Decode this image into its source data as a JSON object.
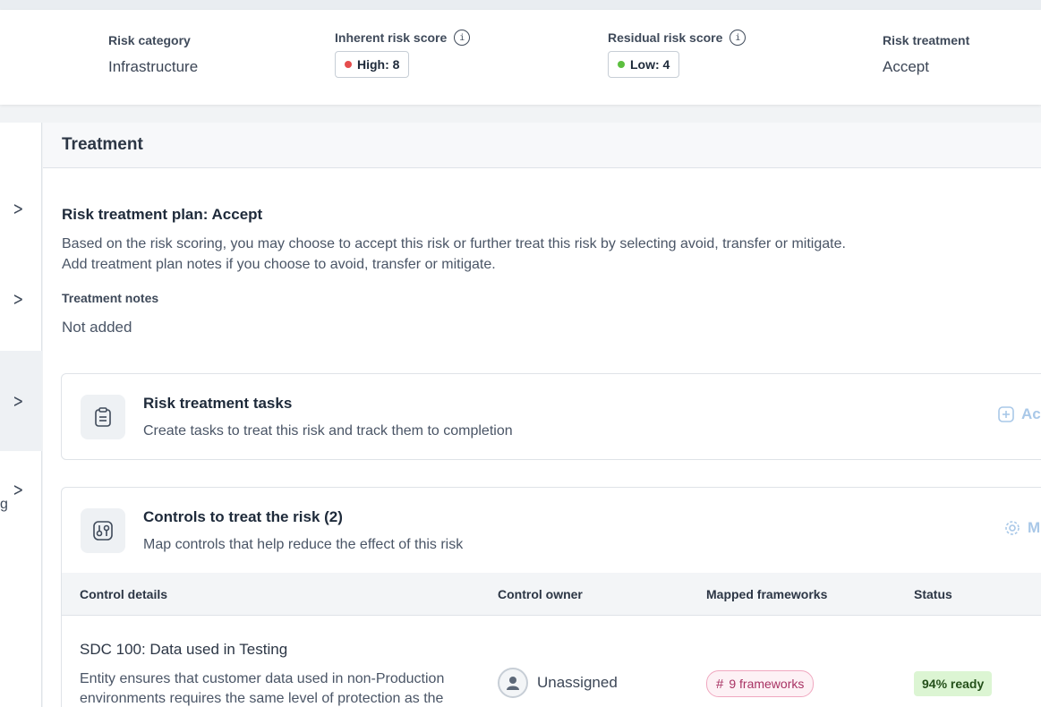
{
  "summary": {
    "risk_category": {
      "label": "Risk category",
      "value": "Infrastructure"
    },
    "inherent": {
      "label": "Inherent risk score",
      "info_icon_text": "i",
      "badge": "High: 8",
      "dot_color": "#e54d4d"
    },
    "residual": {
      "label": "Residual risk score",
      "info_icon_text": "i",
      "badge": "Low: 4",
      "dot_color": "#5cbf3f"
    },
    "treatment": {
      "label": "Risk treatment",
      "value": "Accept"
    }
  },
  "left_nav": {
    "partial_text": "g"
  },
  "section": {
    "title": "Treatment",
    "plan_title": "Risk treatment plan: Accept",
    "plan_desc_line1": "Based on the risk scoring, you may choose to accept this risk or further treat this risk by selecting avoid, transfer or mitigate.",
    "plan_desc_line2": "Add treatment plan notes if you choose to avoid, transfer or mitigate.",
    "notes_label": "Treatment notes",
    "notes_value": "Not added"
  },
  "tasks_card": {
    "icon": "clipboard-icon",
    "title": "Risk treatment tasks",
    "subtitle": "Create tasks to treat this risk and track them to completion",
    "action_label": "Ac"
  },
  "controls_card": {
    "icon": "controls-icon",
    "title": "Controls to treat the risk (2)",
    "subtitle": "Map controls that help reduce the effect of this risk",
    "action_label": "M",
    "columns": [
      "Control details",
      "Control owner",
      "Mapped frameworks",
      "Status"
    ],
    "rows": [
      {
        "title": "SDC 100: Data used in Testing",
        "desc_line1": "Entity ensures that customer data used in non-Production",
        "desc_line2": "environments requires the same level of protection as the",
        "owner": "Unassigned",
        "frameworks": "9 frameworks",
        "status": "94% ready"
      }
    ]
  },
  "colors": {
    "accent_link": "#a9c8e8",
    "status_ready_bg": "#dcf5d3",
    "framework_badge_border": "#f0a8c0"
  }
}
